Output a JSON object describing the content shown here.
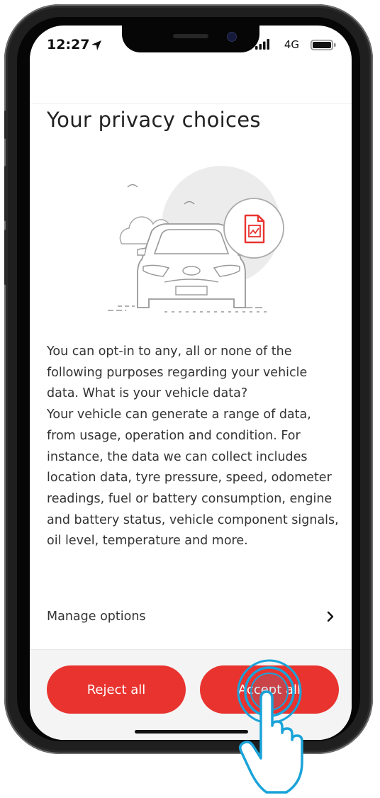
{
  "status_bar": {
    "time": "12:27",
    "network": "4G"
  },
  "page": {
    "title": "Your privacy choices",
    "description": "You can opt-in to any, all or none of the following purposes regarding your vehicle data. What is your vehicle data?\nYour vehicle can generate a range of data, from usage, operation and condition. For instance, the data we can collect includes location data, tyre pressure, speed, odometer readings, fuel or battery consumption, engine and battery status, vehicle component signals, oil level, temperature and more.",
    "manage_options_label": "Manage options"
  },
  "footer": {
    "reject_label": "Reject all",
    "accept_label": "Accept all"
  },
  "icons": [
    "location-arrow-icon",
    "signal-icon",
    "battery-icon",
    "document-chart-icon",
    "chevron-right-icon",
    "tap-hand-icon"
  ],
  "colors": {
    "accent": "#e8332f",
    "tap_highlight": "#1aa3d9"
  }
}
